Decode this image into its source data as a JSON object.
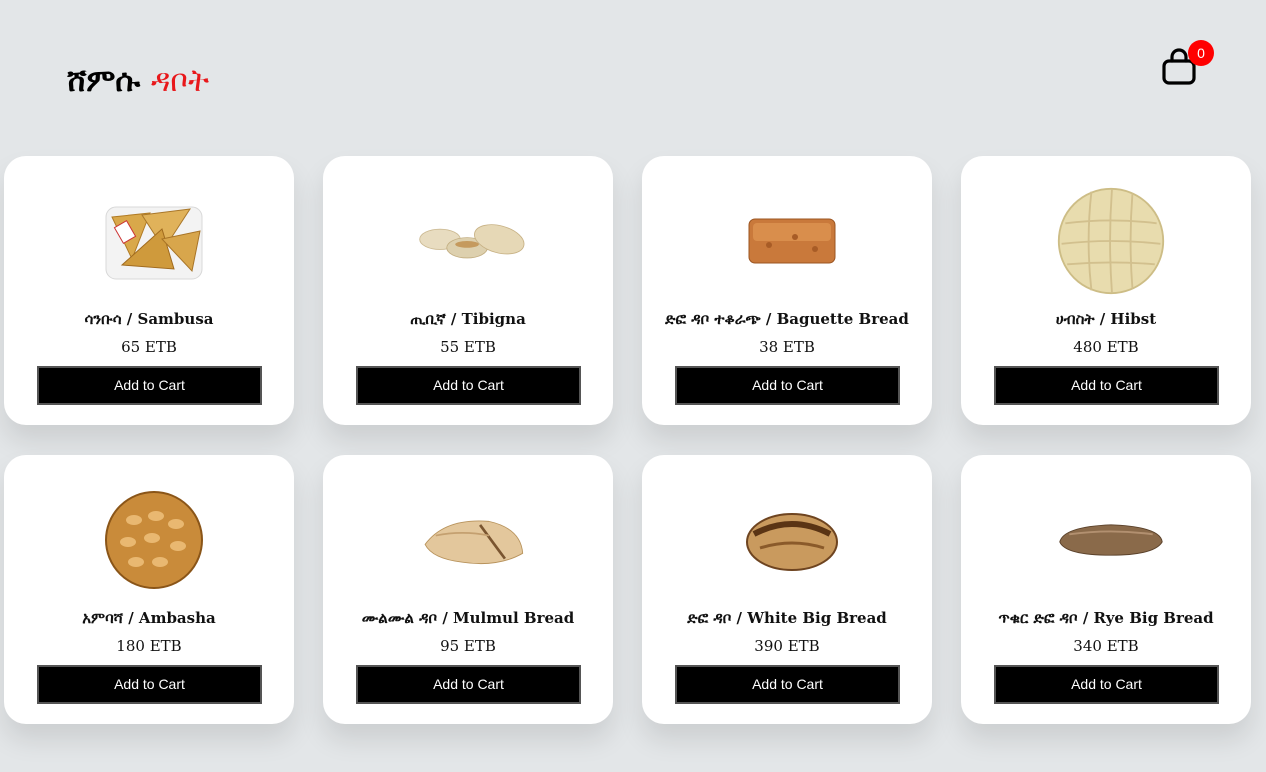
{
  "header": {
    "logo_part1": "ሸምሱ",
    "logo_part2": "ዳቦት",
    "cart_count": "0"
  },
  "products": [
    {
      "name": "ሳንቡሳ / Sambusa",
      "price": "65 ETB",
      "button": "Add to Cart",
      "image": "sambusa"
    },
    {
      "name": "ጢቢኛ / Tibigna",
      "price": "55 ETB",
      "button": "Add to Cart",
      "image": "tibigna"
    },
    {
      "name": "ድፎ ዳቦ ተቆራጭ / Baguette Bread",
      "price": "38 ETB",
      "button": "Add to Cart",
      "image": "baguette"
    },
    {
      "name": "ሀብስት / Hibst",
      "price": "480 ETB",
      "button": "Add to Cart",
      "image": "hibst"
    },
    {
      "name": "አምባሻ / Ambasha",
      "price": "180 ETB",
      "button": "Add to Cart",
      "image": "ambasha"
    },
    {
      "name": "ሙልሙል ዳቦ / Mulmul Bread",
      "price": "95 ETB",
      "button": "Add to Cart",
      "image": "mulmul"
    },
    {
      "name": "ድፎ ዳቦ / White Big Bread",
      "price": "390 ETB",
      "button": "Add to Cart",
      "image": "white-big"
    },
    {
      "name": "ጥቁር ድፎ ዳቦ / Rye Big Bread",
      "price": "340 ETB",
      "button": "Add to Cart",
      "image": "rye-big"
    }
  ]
}
